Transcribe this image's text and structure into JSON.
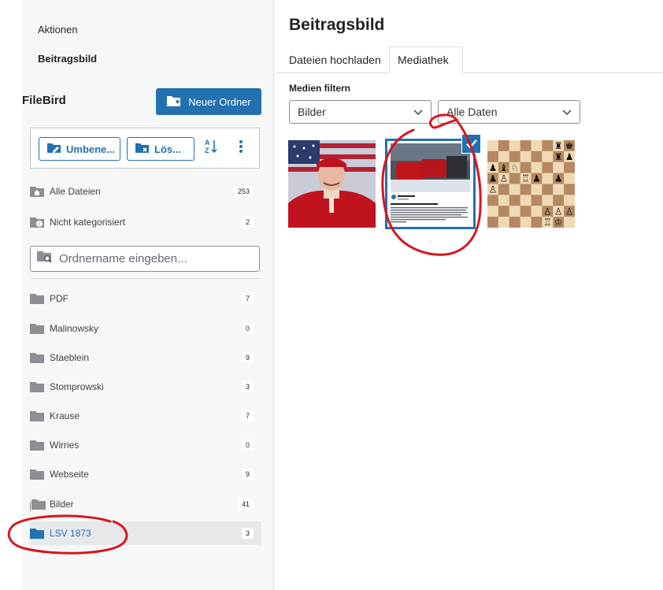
{
  "sidebar": {
    "actions_label": "Aktionen",
    "featured_label": "Beitragsbild",
    "filebird_title": "FileBird",
    "new_folder_label": "Neuer Ordner",
    "toolbar": {
      "rename_label": "Umbene...",
      "delete_label": "Lös...",
      "sort_icon": "sort-az-icon",
      "more_icon": "more-vertical-icon"
    },
    "fixed_items": [
      {
        "label": "Alle Dateien",
        "count": "253",
        "icon": "home-folder-icon"
      },
      {
        "label": "Nicht kategorisiert",
        "count": "2",
        "icon": "uncategorized-folder-icon"
      }
    ],
    "search_placeholder": "Ordnername eingeben...",
    "folders": [
      {
        "label": "PDF",
        "count": "7"
      },
      {
        "label": "Malinowsky",
        "count": "0"
      },
      {
        "label": "Staeblein",
        "count": "9"
      },
      {
        "label": "Stomprowski",
        "count": "3"
      },
      {
        "label": "Krause",
        "count": "7"
      },
      {
        "label": "Wirries",
        "count": "0"
      },
      {
        "label": "Webseite",
        "count": "9"
      },
      {
        "label": "Bilder",
        "count": "41"
      },
      {
        "label": "LSV 1873",
        "count": "3"
      }
    ]
  },
  "main": {
    "title": "Beitragsbild",
    "tabs": [
      {
        "label": "Dateien hochladen",
        "active": false
      },
      {
        "label": "Mediathek",
        "active": true
      }
    ],
    "filter_label": "Medien filtern",
    "filter_type": "Bilder",
    "filter_date": "Alle Daten",
    "thumbnails": [
      {
        "subject": "portrait-man-red-cap-flag",
        "selected": false
      },
      {
        "subject": "social-post-red-car",
        "selected": true
      },
      {
        "subject": "chess-board",
        "selected": false
      }
    ]
  },
  "colors": {
    "accent": "#2271b1",
    "annotation": "#d6161f"
  }
}
